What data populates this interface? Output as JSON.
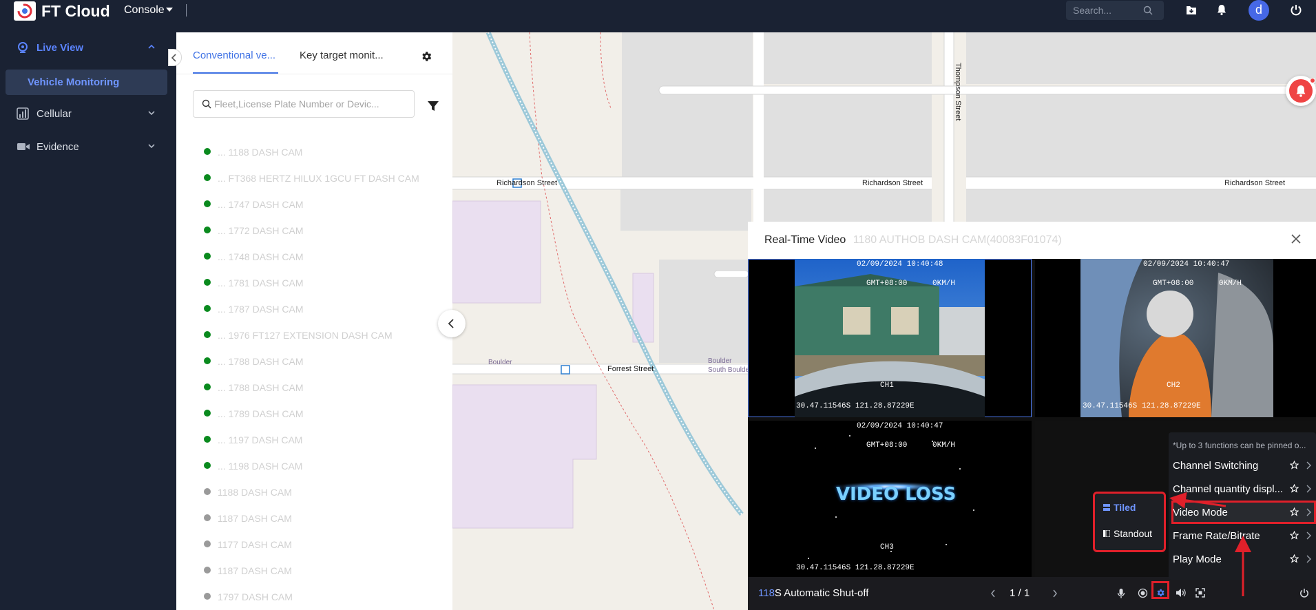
{
  "topbar": {
    "brand": "FT Cloud",
    "console_label": "Console",
    "search_placeholder": "Search...",
    "avatar_letter": "d"
  },
  "sidebar": {
    "items": [
      {
        "label": "Live View",
        "icon": "camera-icon",
        "expanded": true
      },
      {
        "label": "Cellular",
        "icon": "signal-bars-icon",
        "expanded": false
      },
      {
        "label": "Evidence",
        "icon": "video-icon",
        "expanded": false
      }
    ],
    "sub_item": "Vehicle Monitoring"
  },
  "fleet_panel": {
    "tabs": [
      "Conventional ve...",
      "Key target monit..."
    ],
    "active_tab": 0,
    "search_placeholder": "Fleet,License Plate Number or Devic...",
    "vehicles": [
      {
        "label": "... 1188 DASH CAM",
        "online": true
      },
      {
        "label": "... FT368 HERTZ HILUX 1GCU FT DASH CAM",
        "online": true
      },
      {
        "label": "... 1747 DASH CAM",
        "online": true
      },
      {
        "label": "... 1772 DASH CAM",
        "online": true
      },
      {
        "label": "... 1748 DASH CAM",
        "online": true
      },
      {
        "label": "... 1781 DASH CAM",
        "online": true
      },
      {
        "label": "... 1787 DASH CAM",
        "online": true
      },
      {
        "label": "... 1976 FT127 EXTENSION DASH CAM",
        "online": true
      },
      {
        "label": "... 1788 DASH CAM",
        "online": true
      },
      {
        "label": "... 1788 DASH CAM",
        "online": true
      },
      {
        "label": "... 1789 DASH CAM",
        "online": true
      },
      {
        "label": "... 1197 DASH CAM",
        "online": true
      },
      {
        "label": "... 1198 DASH CAM",
        "online": true
      },
      {
        "label": "1188 DASH CAM",
        "online": false
      },
      {
        "label": "1187 DASH CAM",
        "online": false
      },
      {
        "label": "1177 DASH CAM",
        "online": false
      },
      {
        "label": "1187 DASH CAM",
        "online": false
      },
      {
        "label": "1797 DASH CAM",
        "online": false
      }
    ]
  },
  "map": {
    "streets": {
      "richardson": "Richardson Street",
      "forrest": "Forrest Street",
      "thompson": "Thompson Street"
    },
    "places": {
      "boulder": "Boulder",
      "south_boulder": "South Boulder"
    }
  },
  "video": {
    "title": "Real-Time Video",
    "subtitle": "1180 AUTHOB DASH CAM(40083F01074)",
    "channels": [
      {
        "id": "CH1",
        "datetime": "02/09/2024 10:40:48",
        "tz": "GMT+08:00",
        "speed": "0KM/H",
        "coords": "30.47.11546S 121.28.87229E",
        "signal_lost": false
      },
      {
        "id": "CH2",
        "datetime": "02/09/2024 10:40:47",
        "tz": "GMT+08:00",
        "speed": "0KM/H",
        "coords": "30.47.11546S 121.28.87229E",
        "signal_lost": false
      },
      {
        "id": "CH3",
        "datetime": "02/09/2024 10:40:47",
        "tz": "GMT+08:00",
        "speed": "0KM/H",
        "coords": "30.47.11546S 121.28.87229E",
        "signal_lost": true,
        "loss_text": "VIDEO LOSS"
      }
    ],
    "function_menu": {
      "hint": "*Up to 3 functions can be pinned o...",
      "items": [
        "Channel Switching",
        "Channel quantity displ...",
        "Video Mode",
        "Frame Rate/Bitrate",
        "Play Mode"
      ],
      "highlighted": 2
    },
    "video_mode_menu": {
      "items": [
        "Tiled",
        "Standout"
      ],
      "selected": 0
    },
    "footer": {
      "status_number": "118",
      "status_text": "S Automatic Shut-off",
      "pager": "1 / 1"
    }
  },
  "colors": {
    "nav_bg": "#1a2233",
    "accent": "#3f72e5",
    "online": "#0a8a1e",
    "offline": "#9a9a9a",
    "highlight": "#e0202a",
    "alarm": "#ef4444"
  }
}
